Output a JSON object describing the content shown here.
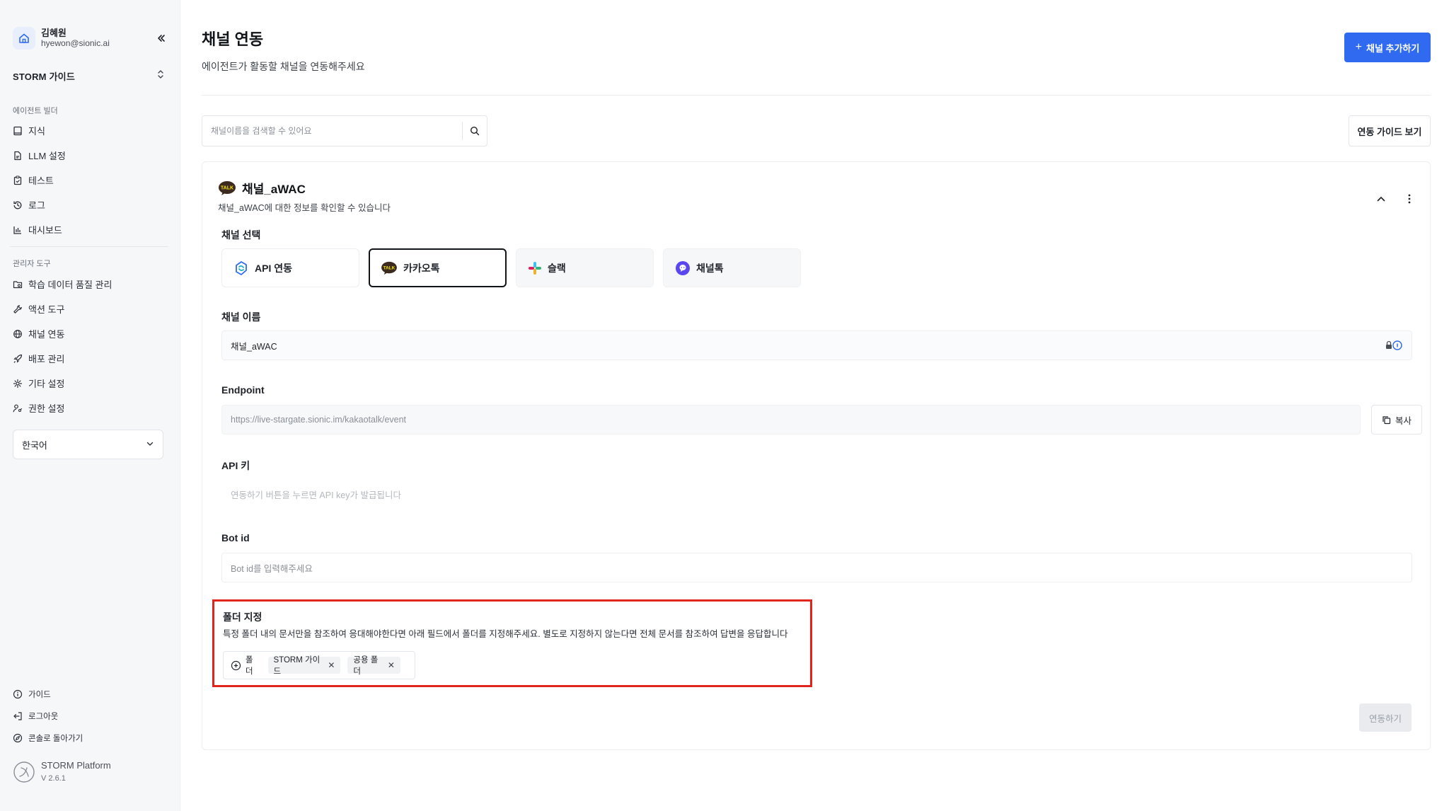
{
  "user": {
    "name": "김혜원",
    "email": "hyewon@sionic.ai"
  },
  "workspace": {
    "label": "STORM 가이드"
  },
  "sidebar": {
    "section_builder": "에이전트 빌더",
    "builder_items": [
      {
        "label": "지식",
        "icon": "book-icon"
      },
      {
        "label": "LLM 설정",
        "icon": "file-icon"
      },
      {
        "label": "테스트",
        "icon": "clipboard-icon"
      },
      {
        "label": "로그",
        "icon": "history-icon"
      },
      {
        "label": "대시보드",
        "icon": "bar-chart-icon"
      }
    ],
    "section_admin": "관리자 도구",
    "admin_items": [
      {
        "label": "학습 데이터 품질 관리",
        "icon": "folder-search-icon"
      },
      {
        "label": "액션 도구",
        "icon": "wrench-icon"
      },
      {
        "label": "채널 연동",
        "icon": "globe-icon"
      },
      {
        "label": "배포 관리",
        "icon": "rocket-icon"
      },
      {
        "label": "기타 설정",
        "icon": "gear-icon"
      },
      {
        "label": "권한 설정",
        "icon": "user-key-icon"
      }
    ],
    "language": "한국어",
    "footer_items": [
      {
        "label": "가이드",
        "icon": "info-icon"
      },
      {
        "label": "로그아웃",
        "icon": "logout-icon"
      },
      {
        "label": "콘솔로 돌아가기",
        "icon": "compass-icon"
      }
    ],
    "brand": {
      "name": "STORM Platform",
      "version": "V 2.6.1"
    }
  },
  "header": {
    "title": "채널 연동",
    "subtitle": "에이전트가 활동할 채널을 연동해주세요",
    "add_button": "채널 추가하기",
    "guide_button": "연동 가이드 보기",
    "search_placeholder": "채널이름을 검색할 수 있어요"
  },
  "channel": {
    "title": "채널_aWAC",
    "description": "채널_aWAC에 대한 정보를 확인할 수 있습니다",
    "select_label": "채널 선택",
    "options": [
      {
        "label": "API 연동",
        "icon": "api-icon"
      },
      {
        "label": "카카오톡",
        "icon": "kakaotalk-icon",
        "selected": true
      },
      {
        "label": "슬랙",
        "icon": "slack-icon"
      },
      {
        "label": "채널톡",
        "icon": "channeltalk-icon"
      }
    ],
    "name_label": "채널 이름",
    "name_value": "채널_aWAC",
    "endpoint_label": "Endpoint",
    "endpoint_value": "https://live-stargate.sionic.im/kakaotalk/event",
    "copy_button": "복사",
    "apikey_label": "API 키",
    "apikey_placeholder": "연동하기 버튼을 누르면 API key가 발급됩니다",
    "botid_label": "Bot id",
    "botid_placeholder": "Bot id를 입력해주세요",
    "folder_label": "폴더 지정",
    "folder_description": "특정 폴더 내의 문서만을 참조하여 응대해야한다면 아래 필드에서 폴더를 지정해주세요. 별도로 지정하지 않는다면 전체 문서를 참조하여 답변을 응답합니다",
    "folder_add_label": "폴더",
    "folder_chips": [
      "STORM 가이드",
      "공용 폴더"
    ],
    "connect_button": "연동하기"
  },
  "colors": {
    "primary": "#2f6af0",
    "highlight": "#e0261c"
  }
}
